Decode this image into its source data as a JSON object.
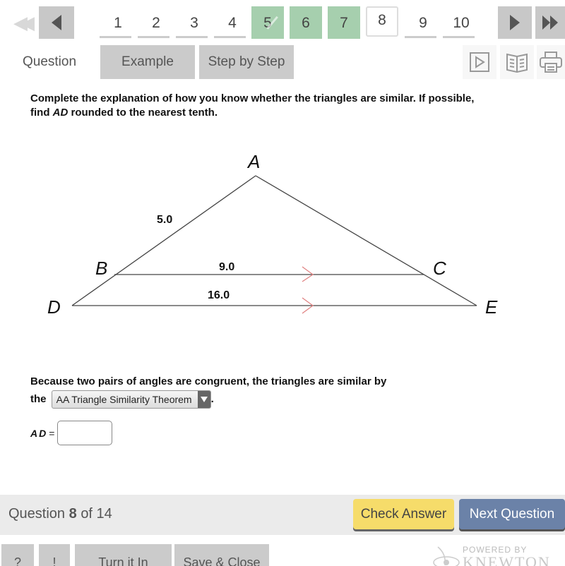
{
  "nav": {
    "first_icon": "double-chevron-left-icon",
    "prev_icon": "triangle-left-icon",
    "next_icon": "triangle-right-icon",
    "last_icon": "double-triangle-right-icon",
    "pages": [
      {
        "label": "1",
        "state": "unvisited"
      },
      {
        "label": "2",
        "state": "unvisited"
      },
      {
        "label": "3",
        "state": "unvisited"
      },
      {
        "label": "4",
        "state": "unvisited"
      },
      {
        "label": "5",
        "state": "completed"
      },
      {
        "label": "6",
        "state": "completed"
      },
      {
        "label": "7",
        "state": "completed"
      },
      {
        "label": "8",
        "state": "current"
      },
      {
        "label": "9",
        "state": "unvisited"
      },
      {
        "label": "10",
        "state": "unvisited"
      }
    ]
  },
  "tabs": {
    "question": "Question",
    "example": "Example",
    "step_by_step": "Step by Step"
  },
  "tools": [
    "play-video-icon",
    "book-icon",
    "print-icon"
  ],
  "prompt": {
    "line1": "Complete the explanation of how you know whether the triangles are similar. If possible,",
    "line2_pre": "find ",
    "line2_var": "AD",
    "line2_post": " rounded to the nearest tenth."
  },
  "diagram": {
    "vertices": {
      "A": "A",
      "B": "B",
      "C": "C",
      "D": "D",
      "E": "E"
    },
    "labels": {
      "AB": "5.0",
      "BC": "9.0",
      "DE": "16.0"
    },
    "parallel_mark_color": "#e08080"
  },
  "explanation": {
    "text": "Because two pairs of angles are congruent, the triangles are similar by",
    "the": "the",
    "selected_option": "AA Triangle Similarity Theorem",
    "period": "."
  },
  "answer": {
    "label": "AD",
    "eq": "=",
    "value": ""
  },
  "footer": {
    "question_word": "Question",
    "current": "8",
    "of_total": "of 14",
    "check_answer": "Check Answer",
    "next_question": "Next Question",
    "colors": {
      "check": "#f6dc6a",
      "next": "#6b82a8",
      "completed": "#a6cfae"
    }
  },
  "bottom": {
    "help": "?",
    "info": "!",
    "turn_in": "Turn it In",
    "save_close": "Save & Close",
    "powered_by": "POWERED BY",
    "brand": "KNEWTON"
  }
}
